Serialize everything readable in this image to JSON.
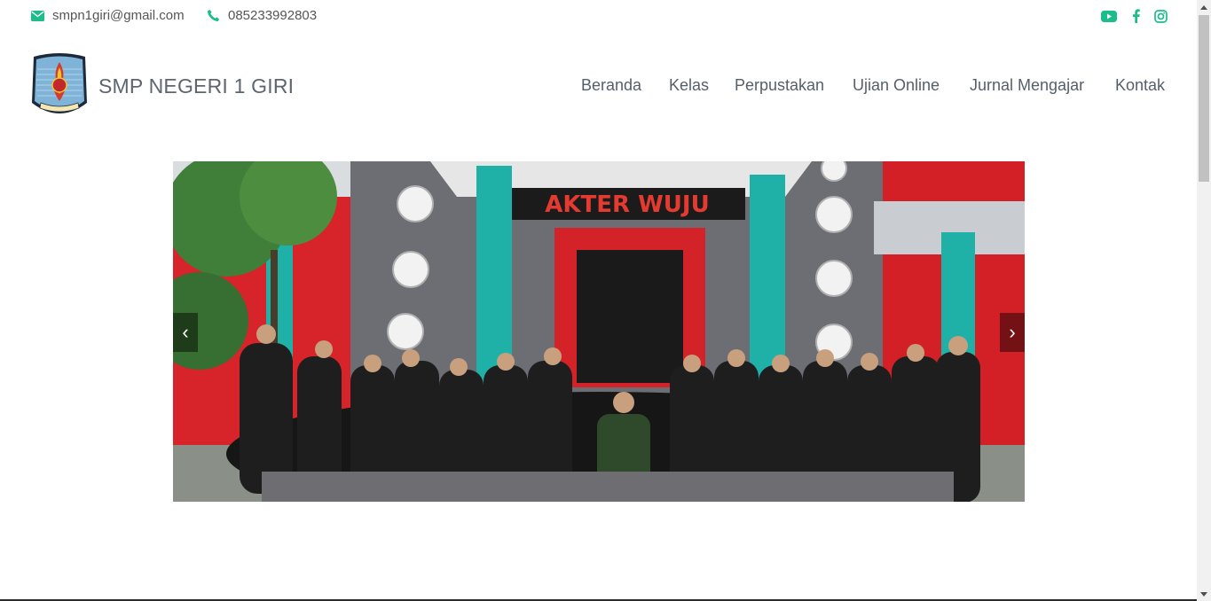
{
  "topbar": {
    "email": "smpn1giri@gmail.com",
    "phone": "085233992803",
    "social": [
      "youtube-icon",
      "facebook-icon",
      "instagram-icon"
    ]
  },
  "brand": {
    "name": "SMP NEGERI 1 GIRI"
  },
  "nav": {
    "items": [
      "Beranda",
      "Kelas",
      "Perpustakan",
      "Ujian Online",
      "Jurnal Mengajar",
      "Kontak"
    ]
  },
  "carousel": {
    "sign_text": "AKTER WUJU",
    "prev": "‹",
    "next": "›"
  },
  "colors": {
    "accent": "#1bbd8a",
    "nav_text": "#555f69",
    "brand_text": "#5d6670"
  }
}
